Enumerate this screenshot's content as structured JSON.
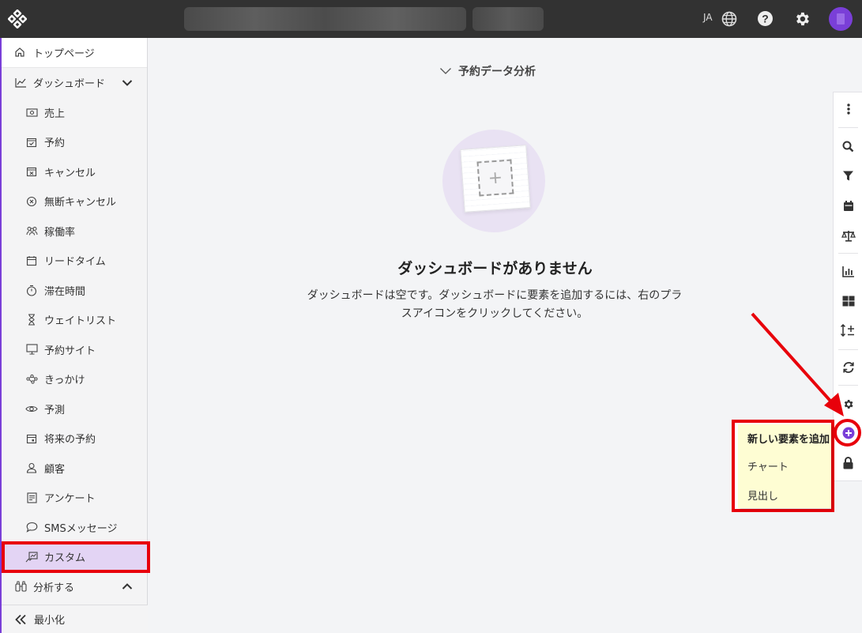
{
  "header": {
    "language": "JA"
  },
  "sidebar": {
    "top": "トップページ",
    "dashboard_group": "ダッシュボード",
    "items": [
      {
        "label": "売上",
        "icon": "money-icon"
      },
      {
        "label": "予約",
        "icon": "calendar-check-icon"
      },
      {
        "label": "キャンセル",
        "icon": "calendar-x-icon"
      },
      {
        "label": "無断キャンセル",
        "icon": "circle-x-icon"
      },
      {
        "label": "稼働率",
        "icon": "people-icon"
      },
      {
        "label": "リードタイム",
        "icon": "calendar-icon"
      },
      {
        "label": "滞在時間",
        "icon": "stopwatch-icon"
      },
      {
        "label": "ウェイトリスト",
        "icon": "hourglass-icon"
      },
      {
        "label": "予約サイト",
        "icon": "monitor-icon"
      },
      {
        "label": "きっかけ",
        "icon": "share-icon"
      },
      {
        "label": "予測",
        "icon": "eye-icon"
      },
      {
        "label": "将来の予約",
        "icon": "calendar-future-icon"
      },
      {
        "label": "顧客",
        "icon": "person-icon"
      },
      {
        "label": "アンケート",
        "icon": "form-icon"
      },
      {
        "label": "SMSメッセージ",
        "icon": "chat-icon"
      },
      {
        "label": "カスタム",
        "icon": "custom-chart-icon"
      }
    ],
    "analyze_group": "分析する",
    "minimize": "最小化"
  },
  "main": {
    "title": "予約データ分析",
    "empty_title": "ダッシュボードがありません",
    "empty_desc": "ダッシュボードは空です。ダッシュボードに要素を追加するには、右のプラスアイコンをクリックしてください。"
  },
  "popup": {
    "header": "新しい要素を追加",
    "items": [
      "チャート",
      "見出し"
    ]
  },
  "colors": {
    "accent": "#7a3fd8",
    "highlight": "#e8000b",
    "active_bg": "#e3d4f4",
    "popup_bg": "#fefdd3"
  }
}
